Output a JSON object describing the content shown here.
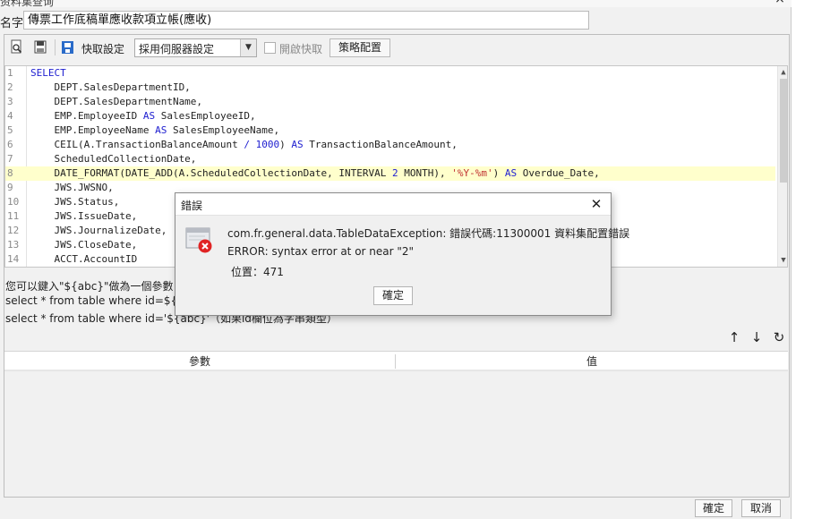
{
  "outer": {
    "title_partial": "资料集查询",
    "close": "×",
    "name_label": "名字:",
    "name_value": "傳票工作底稿單應收款項立帳(應收)"
  },
  "toolbar": {
    "fetch_setting_label": "快取設定",
    "fetch_select_value": "採用伺服器設定",
    "enable_cache_label": "開啟快取",
    "strategy_button": "策略配置"
  },
  "editor": {
    "lines": [
      {
        "n": "1",
        "html": "<span class=\"kw\">SELECT</span>"
      },
      {
        "n": "2",
        "html": "    DEPT.SalesDepartmentID,"
      },
      {
        "n": "3",
        "html": "    DEPT.SalesDepartmentName,"
      },
      {
        "n": "4",
        "html": "    EMP.EmployeeID <span class=\"kw\">AS</span> SalesEmployeeID,"
      },
      {
        "n": "5",
        "html": "    EMP.EmployeeName <span class=\"kw\">AS</span> SalesEmployeeName,"
      },
      {
        "n": "6",
        "html": "    CEIL(A.TransactionBalanceAmount <span class=\"kw\">/</span> <span class=\"num\">1000</span>) <span class=\"kw\">AS</span> TransactionBalanceAmount,"
      },
      {
        "n": "7",
        "html": "    ScheduledCollectionDate,"
      },
      {
        "n": "8",
        "html": "    DATE_FORMAT(DATE_ADD(A.ScheduledCollectionDate, INTERVAL <span class=\"num\">2</span> MONTH), <span class=\"str\">'%Y-%m'</span>) <span class=\"kw\">AS</span> Overdue_Date,",
        "hl": true
      },
      {
        "n": "9",
        "html": "    JWS.JWSNO,"
      },
      {
        "n": "10",
        "html": "    JWS.Status,"
      },
      {
        "n": "11",
        "html": "    JWS.IssueDate,"
      },
      {
        "n": "12",
        "html": "    JWS.JournalizeDate,"
      },
      {
        "n": "13",
        "html": "    JWS.CloseDate,"
      },
      {
        "n": "14",
        "html": "    ACCT.AccountID"
      }
    ]
  },
  "hints": {
    "line1": "您可以鍵入\"${abc}\"做為一個參數，",
    "line2": "select * from table where id=${abc}",
    "line3": "select * from table where id='${abc}'（如果id欄位為字串類型）"
  },
  "params": {
    "col_param": "參數",
    "col_value": "值"
  },
  "footer": {
    "ok": "確定",
    "cancel": "取消"
  },
  "error_dialog": {
    "title": "錯誤",
    "line1": "com.fr.general.data.TableDataException: 錯誤代碼:11300001 資料集配置錯誤",
    "line2": "ERROR: syntax error at or near \"2\"",
    "line3": "位置：471",
    "ok": "確定",
    "icon_color": "#e02424"
  }
}
